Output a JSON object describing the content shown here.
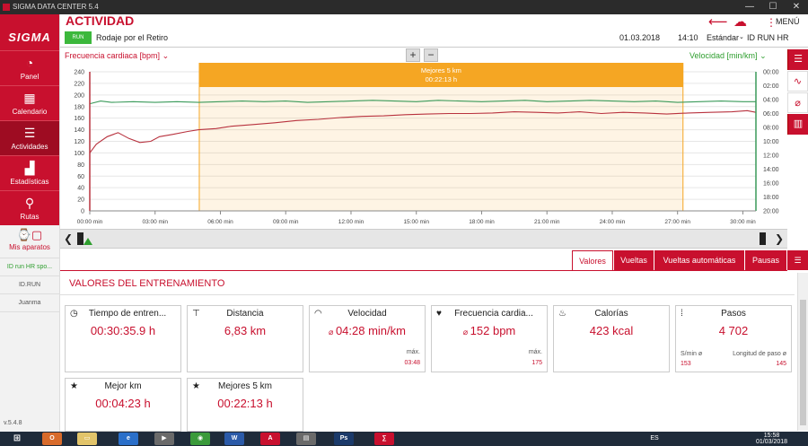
{
  "window": {
    "title": "SIGMA DATA CENTER 5.4",
    "min": "—",
    "max": "☐",
    "close": "✕"
  },
  "sidebar": {
    "logo": "SIGMA",
    "items": [
      {
        "label": "Panel",
        "icon": "gauge-icon"
      },
      {
        "label": "Calendario",
        "icon": "calendar-icon"
      },
      {
        "label": "Actividades",
        "icon": "list-icon"
      },
      {
        "label": "Estadísticas",
        "icon": "bar-chart-icon"
      },
      {
        "label": "Rutas",
        "icon": "route-pin-icon"
      }
    ],
    "devices_label": "Mis aparatos",
    "device_rows": [
      "ID run HR spo...",
      "ID.RUN",
      "Juanma"
    ],
    "version": "v.5.4.8"
  },
  "header": {
    "title": "ACTIVIDAD",
    "sport_badge": "RUN",
    "activity_name": "Rodaje por el Retiro",
    "date": "01.03.2018",
    "time": "14:10",
    "view": "Estándar",
    "device": "ID RUN HR",
    "menu_label": "MENÚ"
  },
  "chart": {
    "left_axis_title": "Frecuencia cardiaca [bpm]",
    "right_axis_title": "Velocidad [min/km]",
    "zoom_in": "+",
    "zoom_out": "−",
    "highlight_title": "Mejores 5 km",
    "highlight_time": "00:22:13 h",
    "colors": {
      "hr": "#b8323e",
      "speed": "#3a9a5a",
      "highlight": "#f5a623"
    }
  },
  "chart_data": {
    "type": "line",
    "x_unit": "min",
    "x_ticks": [
      "00:00 min",
      "03:00 min",
      "06:00 min",
      "09:00 min",
      "12:00 min",
      "15:00 min",
      "18:00 min",
      "21:00 min",
      "24:00 min",
      "27:00 min",
      "30:00 min"
    ],
    "xlim": [
      0,
      30.6
    ],
    "y_left_ticks": [
      "240",
      "220",
      "200",
      "180",
      "160",
      "140",
      "120",
      "100",
      "80",
      "60",
      "40",
      "20",
      "0"
    ],
    "ylim_left": [
      0,
      240
    ],
    "y_right_ticks": [
      "00:00",
      "02:00",
      "04:00",
      "06:00",
      "08:00",
      "10:00",
      "12:00",
      "14:00",
      "16:00",
      "18:00",
      "20:00"
    ],
    "ylim_right_min_per_km": [
      0,
      20
    ],
    "highlight_range_min": [
      5.03,
      27.25
    ],
    "series": [
      {
        "name": "Frecuencia cardiaca [bpm]",
        "axis": "left",
        "x": [
          0,
          0.3,
          0.8,
          1.3,
          1.8,
          2.3,
          2.8,
          3.2,
          3.8,
          4.5,
          5,
          5.8,
          6.5,
          7.5,
          8.5,
          9.5,
          10.5,
          11.5,
          12.5,
          13.5,
          14.5,
          15.5,
          16.5,
          17.5,
          18.5,
          19.5,
          20.5,
          21.5,
          22.5,
          23.5,
          24.5,
          25.5,
          26.5,
          27.5,
          28.5,
          29.5,
          30.2,
          30.6
        ],
        "y": [
          100,
          115,
          128,
          135,
          125,
          118,
          120,
          128,
          132,
          137,
          140,
          142,
          146,
          149,
          152,
          156,
          158,
          161,
          163,
          164,
          166,
          167,
          168,
          168,
          169,
          171,
          170,
          169,
          171,
          168,
          170,
          169,
          167,
          169,
          170,
          171,
          173,
          170
        ]
      },
      {
        "name": "Velocidad [min/km]",
        "axis": "right",
        "x": [
          0,
          0.5,
          1,
          2,
          3,
          4,
          5,
          6,
          7,
          8,
          9,
          10,
          11,
          12,
          13,
          14,
          15,
          16,
          17,
          18,
          19,
          20,
          21,
          22,
          23,
          24,
          25,
          26,
          27,
          28,
          29,
          30,
          30.6
        ],
        "y": [
          4.6,
          4.2,
          4.4,
          4.3,
          4.4,
          4.3,
          4.4,
          4.3,
          4.2,
          4.3,
          4.2,
          4.4,
          4.3,
          4.2,
          4.1,
          4.2,
          4.3,
          4.1,
          4.2,
          4.3,
          4.2,
          4.1,
          4.3,
          4.2,
          4.1,
          4.2,
          4.3,
          4.2,
          4.4,
          4.3,
          4.2,
          4.3,
          4.3
        ]
      }
    ]
  },
  "tabs": [
    "Valores",
    "Vueltas",
    "Vueltas automáticas",
    "Pausas"
  ],
  "section_title": "VALORES DEL ENTRENAMIENTO",
  "cards": [
    {
      "label": "Tiempo de entren...",
      "value": "00:30:35.9 h",
      "icon": "stopwatch-icon"
    },
    {
      "label": "Distancia",
      "value": "6,83 km",
      "icon": "distance-marker-icon"
    },
    {
      "label": "Velocidad",
      "value": "04:28 min/km",
      "icon": "speedometer-icon",
      "max_label": "máx.",
      "max_value": "03:48"
    },
    {
      "label": "Frecuencia cardia...",
      "value": "152 bpm",
      "icon": "heart-icon",
      "max_label": "máx.",
      "max_value": "175"
    },
    {
      "label": "Calorías",
      "value": "423 kcal",
      "icon": "flame-icon"
    },
    {
      "label": "Pasos",
      "value": "4 702",
      "icon": "footsteps-icon",
      "cad_label": "S/min ø",
      "cad_value": "153",
      "stride_label": "Longitud de paso ø",
      "stride_value": "145"
    },
    {
      "label": "Mejor km",
      "value": "00:04:23 h",
      "icon": "star-icon"
    },
    {
      "label": "Mejores 5 km",
      "value": "00:22:13 h",
      "icon": "star-icon"
    }
  ],
  "taskbar": {
    "lang": "ES",
    "time": "15:58",
    "date": "01/03/2018"
  }
}
